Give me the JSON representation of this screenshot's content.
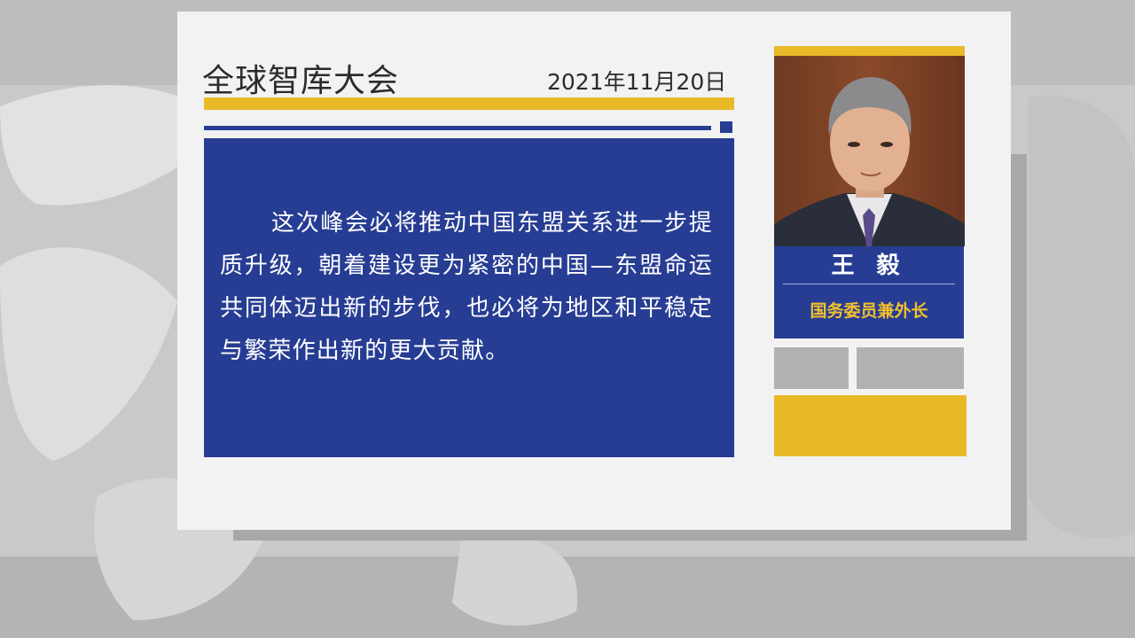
{
  "header": {
    "title": "全球智库大会",
    "date": "2021年11月20日"
  },
  "quote": {
    "text": "这次峰会必将推动中国东盟关系进一步提质升级，朝着建设更为紧密的中国—东盟命运共同体迈出新的步伐，也必将为地区和平稳定与繁荣作出新的更大贡献。"
  },
  "speaker": {
    "name": "王 毅",
    "role": "国务委员兼外长",
    "photo_icon": "portrait-photo"
  },
  "colors": {
    "accent_yellow": "#e9b927",
    "accent_blue": "#273d93",
    "card_background": "#f2f2f2",
    "role_text": "#f2c02c"
  }
}
